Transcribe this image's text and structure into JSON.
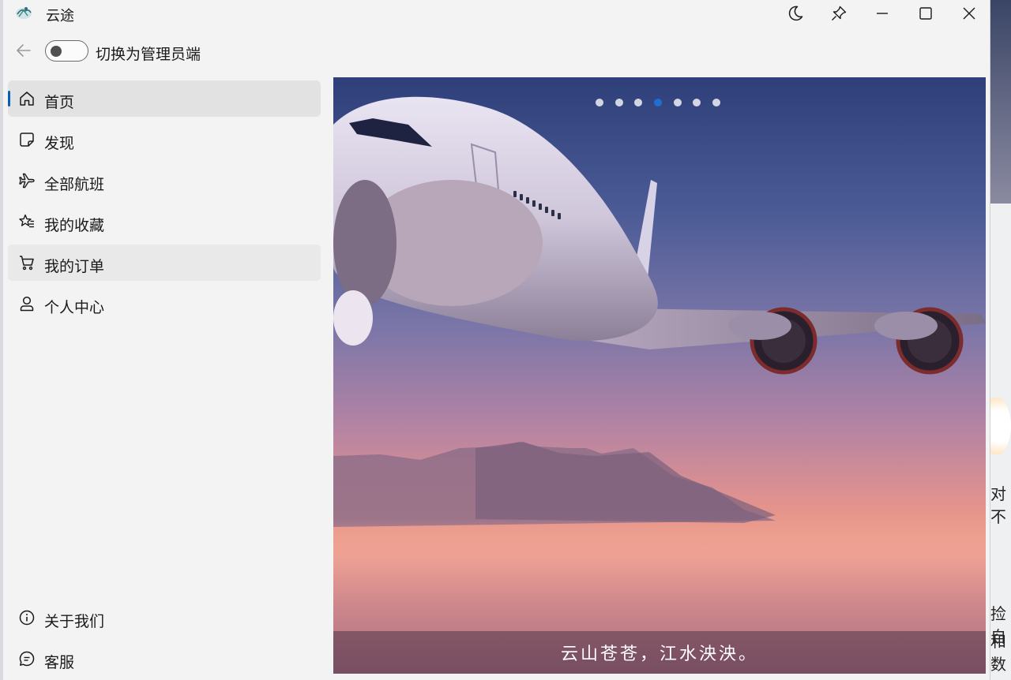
{
  "window": {
    "title": "云途"
  },
  "titlebar": {
    "icons": [
      "moon-icon",
      "pin-icon",
      "minimize-icon",
      "maximize-icon",
      "close-icon"
    ]
  },
  "toolbar": {
    "back_icon": "arrow-left-icon",
    "toggle_label": "切换为管理员端",
    "toggle_on": false
  },
  "nav": {
    "items": [
      {
        "label": "首页",
        "icon": "home-icon",
        "selected": true
      },
      {
        "label": "发现",
        "icon": "note-icon",
        "selected": false
      },
      {
        "label": "全部航班",
        "icon": "airplane-icon",
        "selected": false
      },
      {
        "label": "我的收藏",
        "icon": "star-list-icon",
        "selected": false
      },
      {
        "label": "我的订单",
        "icon": "cart-icon",
        "selected": false
      },
      {
        "label": "个人中心",
        "icon": "person-icon",
        "selected": false
      }
    ],
    "footer": [
      {
        "label": "关于我们",
        "icon": "info-icon"
      },
      {
        "label": "客服",
        "icon": "chat-icon"
      }
    ]
  },
  "carousel": {
    "caption": "云山苍苍，江水泱泱。",
    "slide_count": 7,
    "active_index": 3,
    "accent_color": "#1f6fd0"
  },
  "background_fragments": [
    "对不",
    "捡自",
    "和数"
  ],
  "colors": {
    "accent": "#0a5db8",
    "window_bg": "#f3f3f3",
    "selected_bg": "#e2e2e2"
  }
}
